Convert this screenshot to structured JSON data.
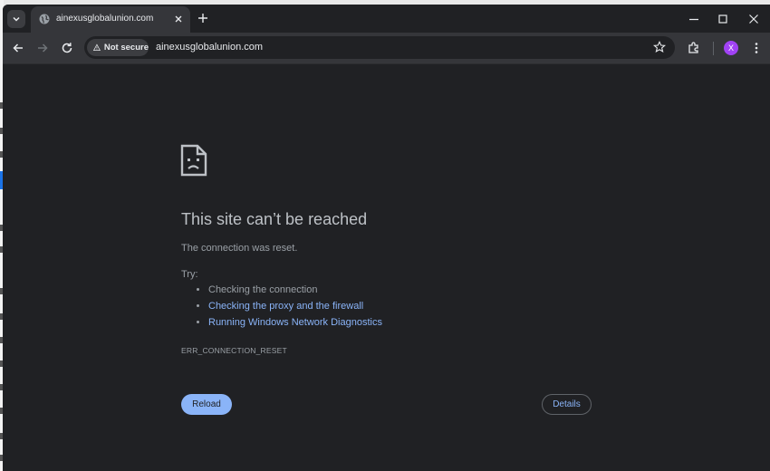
{
  "browser": {
    "tab": {
      "title": "ainexusglobalunion.com"
    },
    "omnibox": {
      "security_label": "Not secure",
      "url": "ainexusglobalunion.com"
    },
    "profile": {
      "initial": "X",
      "color": "#a142f4"
    }
  },
  "error_page": {
    "headline": "This site can’t be reached",
    "description": "The connection was reset.",
    "try_label": "Try:",
    "suggestions": [
      {
        "text": "Checking the connection",
        "is_link": false
      },
      {
        "text": "Checking the proxy and the firewall",
        "is_link": true
      },
      {
        "text": "Running Windows Network Diagnostics",
        "is_link": true
      }
    ],
    "error_code": "ERR_CONNECTION_RESET",
    "reload_label": "Reload",
    "details_label": "Details"
  },
  "colors": {
    "background": "#202124",
    "toolbar": "#35363a",
    "link": "#8ab4f8",
    "primary_button": "#8ab4f8"
  }
}
